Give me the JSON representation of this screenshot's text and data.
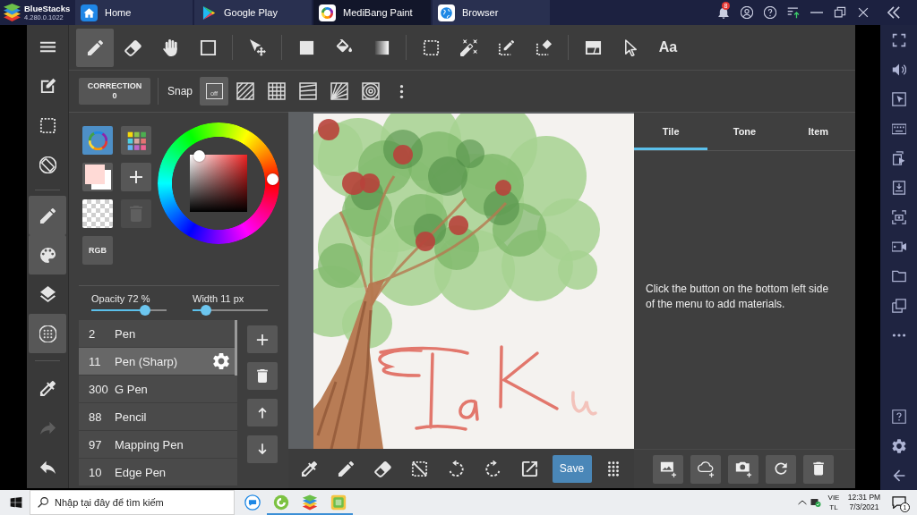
{
  "emulator": {
    "title": "BlueStacks",
    "version": "4.280.0.1022",
    "tabs": [
      {
        "kind": "home",
        "label": "Home",
        "selected": false
      },
      {
        "kind": "store",
        "label": "Google Play",
        "selected": false
      },
      {
        "kind": "paint",
        "label": "MediBang Paint",
        "selected": true
      },
      {
        "kind": "browser",
        "label": "Browser",
        "selected": false
      }
    ],
    "notification_badge": "8"
  },
  "side_rail": [
    {
      "kind": "menu",
      "selected": false,
      "disabled": false
    },
    {
      "kind": "new",
      "selected": false,
      "disabled": false
    },
    {
      "kind": "select",
      "selected": false,
      "disabled": false
    },
    {
      "kind": "rotate",
      "selected": false,
      "disabled": false
    },
    {
      "kind": "brush",
      "selected": true,
      "disabled": false
    },
    {
      "kind": "color",
      "selected": true,
      "disabled": false
    },
    {
      "kind": "layer",
      "selected": false,
      "disabled": false
    },
    {
      "kind": "material",
      "selected": true,
      "disabled": false
    },
    {
      "kind": "eyedropper",
      "selected": false,
      "disabled": false
    },
    {
      "kind": "redo",
      "selected": false,
      "disabled": true
    },
    {
      "kind": "undo",
      "selected": false,
      "disabled": false
    }
  ],
  "tool_bar": {
    "tools": [
      {
        "kind": "pen",
        "selected": true
      },
      {
        "kind": "eraser",
        "selected": false
      },
      {
        "kind": "hand",
        "selected": false
      },
      {
        "kind": "shape",
        "selected": false
      },
      {
        "kind": "move",
        "selected": false
      },
      {
        "kind": "fill",
        "selected": false
      },
      {
        "kind": "bucket",
        "selected": false
      },
      {
        "kind": "gradient",
        "selected": false
      },
      {
        "kind": "select",
        "selected": false
      },
      {
        "kind": "wand",
        "selected": false
      },
      {
        "kind": "select_pen",
        "selected": false
      },
      {
        "kind": "select_eraser",
        "selected": false
      },
      {
        "kind": "divide",
        "selected": false
      },
      {
        "kind": "operation",
        "selected": false
      },
      {
        "kind": "text",
        "label": "Aa",
        "selected": false
      }
    ]
  },
  "snap_bar": {
    "correction": {
      "label": "CORRECTION",
      "value": "0"
    },
    "label": "Snap",
    "options": [
      {
        "kind": "off",
        "label": "off",
        "selected": true
      },
      {
        "kind": "parallel",
        "selected": false
      },
      {
        "kind": "grid",
        "selected": false
      },
      {
        "kind": "perspective",
        "selected": false
      },
      {
        "kind": "radial",
        "selected": false
      },
      {
        "kind": "concentric",
        "selected": false
      }
    ]
  },
  "color_panel": {
    "modes": [
      {
        "kind": "wheel",
        "selected": true
      },
      {
        "kind": "palette",
        "selected": false
      }
    ],
    "swatches": [
      {
        "kind": "main",
        "color": "#ffdad6"
      },
      {
        "kind": "sub",
        "color": "#ffffff"
      }
    ],
    "actions": [
      {
        "kind": "add",
        "disabled": false
      },
      {
        "kind": "delete",
        "disabled": true
      }
    ],
    "rgb_button": "RGB"
  },
  "brush_panel": {
    "sliders": [
      {
        "label": "Opacity 72 %",
        "level": 0.72
      },
      {
        "label": "Width 11 px",
        "level": 0.18
      }
    ],
    "brushes": [
      {
        "size": "2",
        "name": "Pen",
        "selected": false
      },
      {
        "size": "11",
        "name": "Pen (Sharp)",
        "selected": true
      },
      {
        "size": "300",
        "name": "G Pen",
        "selected": false
      },
      {
        "size": "88",
        "name": "Pencil",
        "selected": false
      },
      {
        "size": "97",
        "name": "Mapping Pen",
        "selected": false
      },
      {
        "size": "10",
        "name": "Edge Pen",
        "selected": false
      }
    ]
  },
  "canvas_toolbar": {
    "save_button": "Save"
  },
  "materials_panel": {
    "tabs": [
      {
        "label": "Tile",
        "selected": true
      },
      {
        "label": "Tone",
        "selected": false
      },
      {
        "label": "Item",
        "selected": false
      }
    ],
    "message": "Click the button on the bottom left side of the menu to add materials."
  },
  "taskbar": {
    "placeholder": "Nhập tại đây để tìm kiếm",
    "apps": [
      {
        "kind": "chat",
        "running": false
      },
      {
        "kind": "round",
        "running": true
      },
      {
        "kind": "stack",
        "running": true
      },
      {
        "kind": "tiles",
        "running": true
      }
    ],
    "language": "VIE",
    "keyboard": "TL",
    "time": "12:31 PM",
    "date": "7/3/2021",
    "notification_count": "1"
  }
}
